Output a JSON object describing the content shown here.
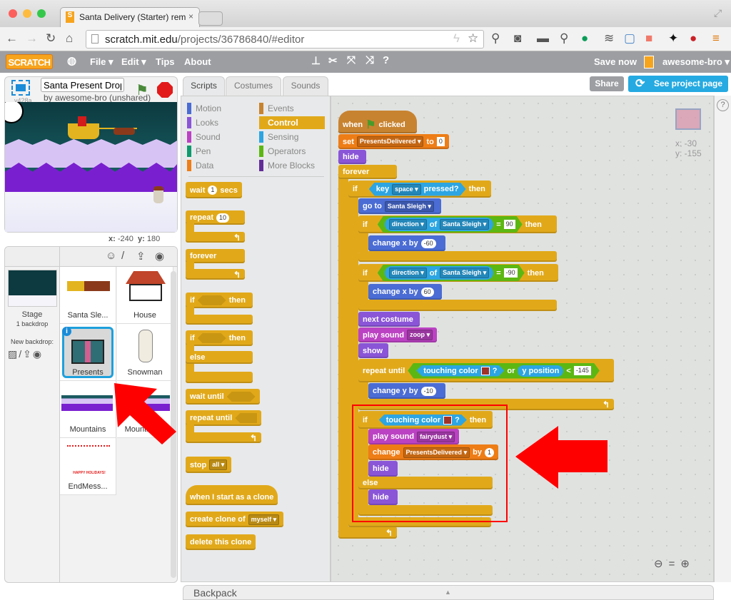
{
  "browser": {
    "tab_title": "Santa Delivery (Starter) rem",
    "url_domain": "scratch.mit.edu",
    "url_path": "/projects/36786840/#editor"
  },
  "menu": {
    "logo": "SCRATCH",
    "file": "File ▾",
    "edit": "Edit ▾",
    "tips": "Tips",
    "about": "About",
    "save_now": "Save now",
    "user": "awesome-bro ▾"
  },
  "project": {
    "title": "Santa Present Drop",
    "byline": "by awesome-bro (unshared)",
    "version": "v428a"
  },
  "stage": {
    "x_label": "x:",
    "x": "-240",
    "y_label": "y:",
    "y": "180"
  },
  "sprites_panel": {
    "stage_label": "Stage",
    "backdrops": "1 backdrop",
    "new_backdrop": "New backdrop:",
    "sprites": [
      {
        "name": "Santa Sle..."
      },
      {
        "name": "House"
      },
      {
        "name": "Presents",
        "selected": true
      },
      {
        "name": "Snowman"
      },
      {
        "name": "Mountains"
      },
      {
        "name": "Mountains2"
      },
      {
        "name": "EndMess..."
      }
    ],
    "endmessage_text": "HAPPY HOLIDAYS!"
  },
  "tabs": [
    {
      "label": "Scripts",
      "active": true
    },
    {
      "label": "Costumes"
    },
    {
      "label": "Sounds"
    }
  ],
  "buttons": {
    "share": "Share",
    "see_project": "See project page"
  },
  "categories": [
    {
      "label": "Motion",
      "color": "#4a6cd4"
    },
    {
      "label": "Looks",
      "color": "#8a55d7"
    },
    {
      "label": "Sound",
      "color": "#bb42c3"
    },
    {
      "label": "Pen",
      "color": "#0e9a6c"
    },
    {
      "label": "Data",
      "color": "#ee7d16"
    },
    {
      "label": "Events",
      "color": "#c88330"
    },
    {
      "label": "Control",
      "color": "#e1a91a",
      "selected": true
    },
    {
      "label": "Sensing",
      "color": "#2ca5e2"
    },
    {
      "label": "Operators",
      "color": "#5cb712"
    },
    {
      "label": "More Blocks",
      "color": "#632d99"
    }
  ],
  "palette": {
    "wait": "wait",
    "wait_val": "1",
    "secs": "secs",
    "repeat": "repeat",
    "repeat_val": "10",
    "forever": "forever",
    "if": "if",
    "then": "then",
    "else": "else",
    "wait_until": "wait until",
    "repeat_until": "repeat until",
    "stop": "stop",
    "stop_val": "all",
    "clone_hat": "when I start as a clone",
    "create_clone": "create clone of",
    "clone_target": "myself",
    "delete_clone": "delete this clone"
  },
  "script": {
    "when": "when",
    "clicked": "clicked",
    "set": "set",
    "var": "PresentsDelivered",
    "to": "to",
    "set_val": "0",
    "hide": "hide",
    "forever": "forever",
    "if": "if",
    "key": "key",
    "key_val": "space",
    "pressed": "pressed?",
    "then": "then",
    "go_to": "go to",
    "sprite": "Santa Sleigh",
    "direction": "direction",
    "of": "of",
    "eq": "=",
    "dir1": "90",
    "dir2": "-90",
    "change_x": "change x by",
    "cx1": "-60",
    "cx2": "60",
    "next_costume": "next costume",
    "play_sound": "play sound",
    "sound1": "zoop",
    "show": "show",
    "repeat_until": "repeat until",
    "touching_color": "touching color",
    "q": "?",
    "or": "or",
    "y_position": "y position",
    "lt": "<",
    "ylimit": "-145",
    "change_y": "change y by",
    "cy": "-10",
    "sound2": "fairydust",
    "change": "change",
    "by": "by",
    "inc": "1",
    "else": "else"
  },
  "sprite_info": {
    "x": "x: -30",
    "y": "y: -155"
  },
  "backpack": "Backpack",
  "colors": {
    "highlight": "#ff0000",
    "accent": "#25aae1"
  }
}
